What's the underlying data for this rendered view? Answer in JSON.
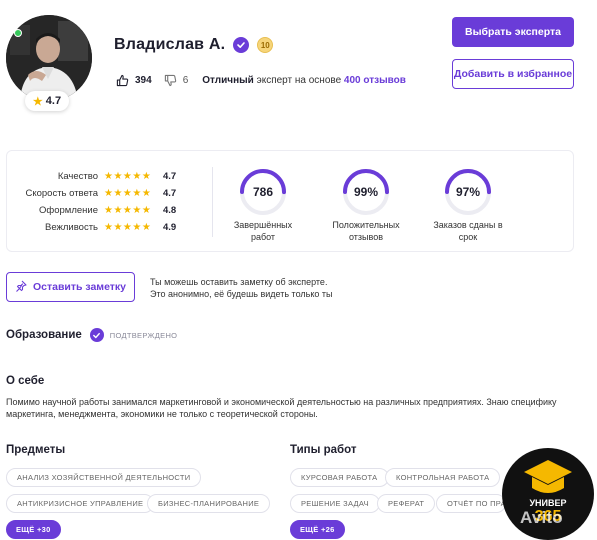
{
  "profile": {
    "name": "Владислав А.",
    "level": "10",
    "rating": "4.7",
    "likes": "394",
    "dislikes": "6",
    "review_prefix_bold": "Отличный",
    "review_middle": " эксперт на основе ",
    "review_count": "400 отзывов"
  },
  "actions": {
    "choose_expert": "Выбрать эксперта",
    "add_favorite": "Добавить в избранное",
    "leave_note": "Оставить заметку",
    "note_hint_line1": "Ты можешь оставить заметку об эксперте.",
    "note_hint_line2": "Это анонимно, её будешь видеть только ты"
  },
  "criteria": [
    {
      "label": "Качество",
      "value": "4.7"
    },
    {
      "label": "Скорость ответа",
      "value": "4.7"
    },
    {
      "label": "Оформление",
      "value": "4.8"
    },
    {
      "label": "Вежливость",
      "value": "4.9"
    }
  ],
  "metrics": [
    {
      "value": "786",
      "caption_line1": "Завершённых",
      "caption_line2": "работ",
      "fill": 0.5
    },
    {
      "value": "99%",
      "caption_line1": "Положительных",
      "caption_line2": "отзывов",
      "fill": 0.5
    },
    {
      "value": "97%",
      "caption_line1": "Заказов сданы в",
      "caption_line2": "срок",
      "fill": 0.5
    }
  ],
  "education": {
    "title": "Образование",
    "status": "ПОДТВЕРЖДЕНО"
  },
  "about": {
    "title": "О себе",
    "text": "Помимо научной работы занимался маркетинговой и экономической деятельностью на различных предприятиях. Знаю специфику маркетинга, менеджмента, экономики не только с теоретической стороны."
  },
  "subjects": {
    "title": "Предметы",
    "chips": [
      "АНАЛИЗ ХОЗЯЙСТВЕННОЙ ДЕЯТЕЛЬНОСТИ",
      "АНТИКРИЗИСНОЕ УПРАВЛЕНИЕ",
      "БИЗНЕС-ПЛАНИРОВАНИЕ"
    ],
    "more": "ЕЩЁ +30"
  },
  "work_types": {
    "title": "Типы работ",
    "chips": [
      "КУРСОВАЯ РАБОТА",
      "КОНТРОЛЬНАЯ РАБОТА",
      "РЕШЕНИЕ ЗАДАЧ",
      "РЕФЕРАТ",
      "ОТЧЁТ ПО ПРА"
    ],
    "more": "ЕЩЁ +26"
  },
  "watermark": {
    "brand": "УНИВЕР",
    "number": "365",
    "avito": "Avito"
  },
  "colors": {
    "accent": "#6a3cd8",
    "star": "#f5b800",
    "online": "#35c85a"
  },
  "icons": {
    "verified": "check-badge-icon",
    "like": "thumb-up-icon",
    "dislike": "thumb-down-icon",
    "note": "pin-icon",
    "star": "star-icon"
  }
}
